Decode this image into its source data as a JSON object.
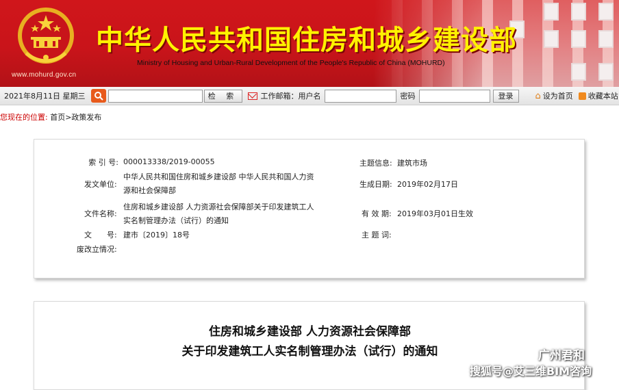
{
  "header": {
    "cn_title": "中华人民共和国住房和城乡建设部",
    "en_title": "Ministry of Housing and Urban-Rural Development of the People's Republic of China (MOHURD)",
    "url": "www.mohurd.gov.cn",
    "colors": {
      "banner_red": "#cc151b",
      "title_yellow": "#fff200"
    }
  },
  "toolbar": {
    "date": "2021年8月11日 星期三",
    "search_icon": "magnifier-icon",
    "search_placeholder": "",
    "search_button": "检 索",
    "mail_label": "工作邮箱：",
    "user_label": "用户名",
    "password_label": "密码",
    "login_button": "登录",
    "set_home": "设为首页",
    "favorite": "收藏本站"
  },
  "breadcrumb": {
    "label": "您现在的位置:",
    "path": "首页>政策发布"
  },
  "info": {
    "index_no_label": "索 引 号:",
    "index_no": "000013338/2019-00055",
    "topic_label": "主题信息:",
    "topic": "建筑市场",
    "issuer_label": "发文单位:",
    "issuer_line1": "中华人民共和国住房和城乡建设部 中华人民共和国人力资",
    "issuer_line2": "源和社会保障部",
    "date_label": "生成日期:",
    "date": "2019年02月17日",
    "name_label": "文件名称:",
    "name_line1": "住房和城乡建设部 人力资源社会保障部关于印发建筑工人",
    "name_line2": "实名制管理办法（试行）的通知",
    "validity_label": "有 效 期:",
    "validity": "2019年03月01日生效",
    "doc_no_label": "文　　号:",
    "doc_no": "建市〔2019〕18号",
    "subject_label": "主 题 词:",
    "subject": "",
    "status_label": "废改立情况:",
    "status": ""
  },
  "content": {
    "title_line1": "住房和城乡建设部 人力资源社会保障部",
    "title_line2": "关于印发建筑工人实名制管理办法（试行）的通知"
  },
  "watermark": {
    "line1": "广州君和",
    "line2": "搜狐号@艾三维BIM咨询"
  }
}
